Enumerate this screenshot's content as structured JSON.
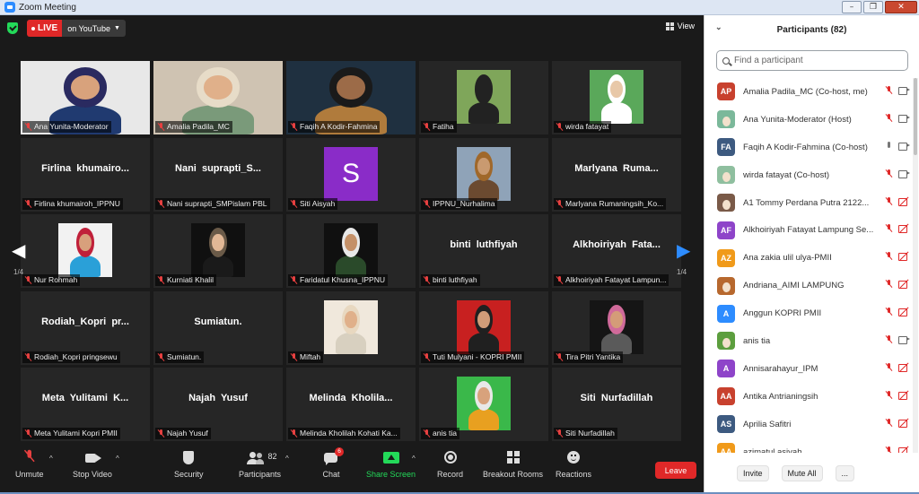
{
  "window": {
    "title": "Zoom Meeting"
  },
  "live": {
    "badge": "LIVE",
    "platform": "on YouTube"
  },
  "view": {
    "label": "View"
  },
  "pagination": {
    "left": "1/4",
    "right": "1/4"
  },
  "tiles": [
    {
      "name": "Ana Yunita-Moderator",
      "big": ""
    },
    {
      "name": "Amalia Padila_MC",
      "big": ""
    },
    {
      "name": "Faqih A Kodir-Fahmina",
      "big": ""
    },
    {
      "name": "Fatiha",
      "big": ""
    },
    {
      "name": "wirda fatayat",
      "big": ""
    },
    {
      "name": "Firlina khumairoh_IPPNU",
      "big": "Firlina  khumairo..."
    },
    {
      "name": "Nani suprapti_SMPislam PBL",
      "big": "Nani  suprapti_S..."
    },
    {
      "name": "Siti Aisyah",
      "big": "S"
    },
    {
      "name": "IPPNU_Nurhalima",
      "big": ""
    },
    {
      "name": "Marlyana Rumaningsih_Ko...",
      "big": "Marlyana  Ruma..."
    },
    {
      "name": "Nur Rohmah",
      "big": ""
    },
    {
      "name": "Kurniati Khalil",
      "big": ""
    },
    {
      "name": "Faridatul Khusna_IPPNU",
      "big": ""
    },
    {
      "name": "binti luthfiyah",
      "big": "binti  luthfiyah"
    },
    {
      "name": "Alkhoiriyah Fatayat Lampun...",
      "big": "Alkhoiriyah  Fata..."
    },
    {
      "name": "Rodiah_Kopri pringsewu",
      "big": "Rodiah_Kopri  pr..."
    },
    {
      "name": "Sumiatun.",
      "big": "Sumiatun."
    },
    {
      "name": "Miftah",
      "big": ""
    },
    {
      "name": "Tuti Mulyani - KOPRI PMII",
      "big": ""
    },
    {
      "name": "Tira Pitri Yantika",
      "big": ""
    },
    {
      "name": "Meta Yulitami Kopri PMII",
      "big": "Meta  Yulitami  K..."
    },
    {
      "name": "Najah Yusuf",
      "big": "Najah  Yusuf"
    },
    {
      "name": "Melinda Kholilah Kohati Ka...",
      "big": "Melinda  Kholila..."
    },
    {
      "name": "anis tia",
      "big": ""
    },
    {
      "name": "Siti Nurfadillah",
      "big": "Siti  Nurfadillah"
    }
  ],
  "toolbar": {
    "unmute": "Unmute",
    "stop_video": "Stop Video",
    "security": "Security",
    "participants": "Participants",
    "participants_count": "82",
    "chat": "Chat",
    "chat_badge": "6",
    "share": "Share Screen",
    "record": "Record",
    "breakout": "Breakout Rooms",
    "reactions": "Reactions",
    "leave": "Leave"
  },
  "panel": {
    "title": "Participants (82)",
    "search_placeholder": "Find a participant",
    "invite": "Invite",
    "mute_all": "Mute All",
    "more": "...",
    "participants": [
      {
        "initials": "AP",
        "color": "#c8412e",
        "name": "Amalia Padila_MC (Co-host, me)",
        "mic": "muted",
        "cam": "on"
      },
      {
        "initials": "",
        "color": "#7bb89a",
        "name": "Ana Yunita-Moderator (Host)",
        "mic": "muted",
        "cam": "on"
      },
      {
        "initials": "FA",
        "color": "#3d5a80",
        "name": "Faqih A Kodir-Fahmina (Co-host)",
        "mic": "on",
        "cam": "on"
      },
      {
        "initials": "",
        "color": "#8fbf9f",
        "name": "wirda fatayat (Co-host)",
        "mic": "muted",
        "cam": "on"
      },
      {
        "initials": "",
        "color": "#7a5a48",
        "name": "A1 Tommy Perdana Putra 2122...",
        "mic": "muted",
        "cam": "off"
      },
      {
        "initials": "AF",
        "color": "#8e44c9",
        "name": "Alkhoiriyah Fatayat Lampung Se...",
        "mic": "muted",
        "cam": "off"
      },
      {
        "initials": "AZ",
        "color": "#f09a1a",
        "name": "Ana zakia ulil ulya-PMII",
        "mic": "muted",
        "cam": "off"
      },
      {
        "initials": "",
        "color": "#b7682e",
        "name": "Andriana_AIMI LAMPUNG",
        "mic": "muted",
        "cam": "off"
      },
      {
        "initials": "A",
        "color": "#2d8cff",
        "name": "Anggun KOPRI PMII",
        "mic": "muted",
        "cam": "off"
      },
      {
        "initials": "",
        "color": "#5c9e3e",
        "name": "anis tia",
        "mic": "muted",
        "cam": "on"
      },
      {
        "initials": "A",
        "color": "#8e44c9",
        "name": "Annisarahayur_IPM",
        "mic": "muted",
        "cam": "off"
      },
      {
        "initials": "AA",
        "color": "#c8412e",
        "name": "Antika Antrianingsih",
        "mic": "muted",
        "cam": "off"
      },
      {
        "initials": "AS",
        "color": "#3d5a80",
        "name": "Aprilia Safitri",
        "mic": "muted",
        "cam": "off"
      },
      {
        "initials": "AA",
        "color": "#f09a1a",
        "name": "azimatul asiyah",
        "mic": "muted",
        "cam": "off"
      }
    ]
  }
}
